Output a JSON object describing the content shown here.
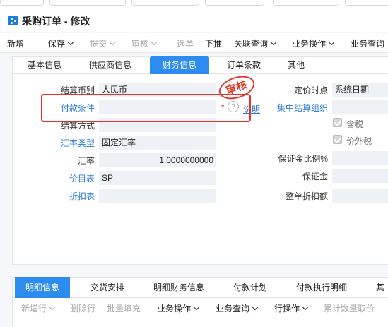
{
  "window": {
    "title": "采购订单 - 修改"
  },
  "toolbar": {
    "items": [
      {
        "label": "新增",
        "dropdown": false,
        "disabled": false
      },
      {
        "label": "保存",
        "dropdown": true,
        "disabled": false
      },
      {
        "label": "提交",
        "dropdown": true,
        "disabled": true
      },
      {
        "label": "审核",
        "dropdown": true,
        "disabled": true
      },
      {
        "label": "选单",
        "dropdown": false,
        "disabled": true
      },
      {
        "label": "下推",
        "dropdown": false,
        "disabled": false
      },
      {
        "label": "关联查询",
        "dropdown": true,
        "disabled": false
      },
      {
        "label": "业务操作",
        "dropdown": true,
        "disabled": false
      },
      {
        "label": "业务查询",
        "dropdown": false,
        "disabled": false
      }
    ]
  },
  "tabs": {
    "items": [
      "基本信息",
      "供应商信息",
      "财务信息",
      "订单条款",
      "其他"
    ],
    "active_index": 2
  },
  "form": {
    "settle_currency_label": "结算币别",
    "settle_currency_value": "人民币",
    "payment_terms_label": "付款条件",
    "payment_terms_value": "",
    "required_mark": "*",
    "help_icon_glyph": "?",
    "explain_link": "说明",
    "settle_method_label": "结算方式",
    "settle_method_value": "",
    "rate_type_label": "汇率类型",
    "rate_type_value": "固定汇率",
    "rate_label": "汇率",
    "rate_value": "1.0000000000",
    "price_list_label": "价目表",
    "price_list_value": "SP",
    "discount_list_label": "折扣表",
    "discount_list_value": "",
    "pricing_point_label": "定价时点",
    "pricing_point_value": "系统日期",
    "central_settle_org_label": "集中结算组织",
    "central_settle_org_value": "",
    "tax_included_label": "含税",
    "tax_included_checked": true,
    "tax_excluded_label": "价外税",
    "tax_excluded_checked": true,
    "deposit_ratio_label": "保证金比例%",
    "deposit_ratio_value": "",
    "deposit_label": "保证金",
    "deposit_value": "",
    "whole_discount_label": "整单折扣额",
    "whole_discount_value": ""
  },
  "stamp": {
    "text": "审核",
    "color": "#e23a2a"
  },
  "highlight": {
    "color": "#e8312a"
  },
  "bottom_tabs": {
    "items": [
      "明细信息",
      "交货安排",
      "明细财务信息",
      "付款计划",
      "付款执行明细",
      "其"
    ],
    "active_index": 0
  },
  "bottom_toolbar": {
    "items": [
      {
        "label": "新增行",
        "dropdown": true,
        "disabled": true
      },
      {
        "label": "删除行",
        "dropdown": false,
        "disabled": true
      },
      {
        "label": "批量填充",
        "dropdown": false,
        "disabled": true
      },
      {
        "label": "业务操作",
        "dropdown": true,
        "disabled": false
      },
      {
        "label": "业务查询",
        "dropdown": true,
        "disabled": false
      },
      {
        "label": "行操作",
        "dropdown": true,
        "disabled": false
      },
      {
        "label": "累计数量取价",
        "dropdown": false,
        "disabled": true
      }
    ]
  },
  "colors": {
    "accent": "#2d8cf0",
    "link": "#2d7ad6",
    "field_bg": "#eef1f5"
  }
}
